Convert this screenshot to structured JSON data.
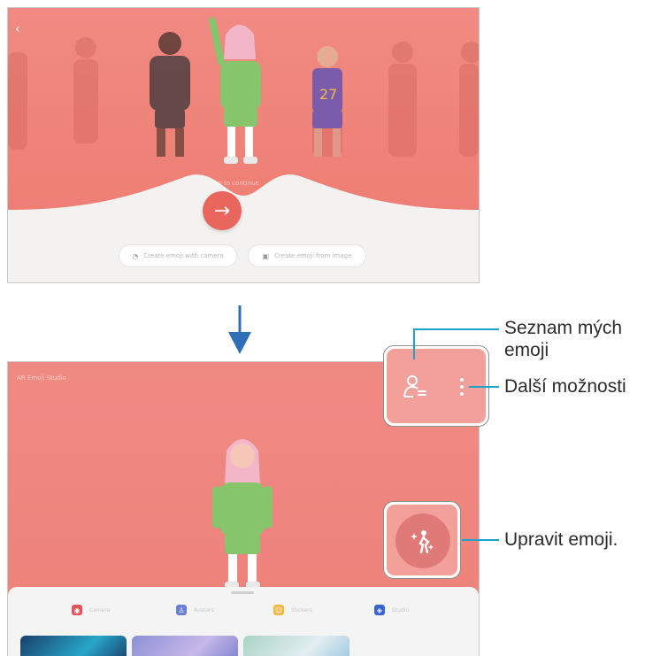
{
  "top_screen": {
    "back_icon": "chevron-left-icon",
    "start_icon": "arrow-right-icon",
    "hint": "Tap to continue",
    "pill_camera": "Create emoji with camera",
    "pill_image": "Create emoji from image"
  },
  "bottom_screen": {
    "title": "AR Emoji Studio",
    "tabs": [
      {
        "label": "Camera",
        "color": "#e8515a"
      },
      {
        "label": "Avatars",
        "color": "#6b7fd6"
      },
      {
        "label": "Stickers",
        "color": "#f4b842"
      },
      {
        "label": "Studio",
        "color": "#3a63d6"
      }
    ]
  },
  "callouts": {
    "my_emoji_list": "Seznam mých emoji",
    "my_emoji_list_line1": "Seznam mých",
    "my_emoji_list_line2": "emoji",
    "more_options": "Další možnosti",
    "edit_emoji": "Upravit emoji."
  },
  "colors": {
    "accent_line": "#1ba3c9",
    "screen_pink": "#ef8177",
    "arrow_blue": "#2e6fb8"
  }
}
